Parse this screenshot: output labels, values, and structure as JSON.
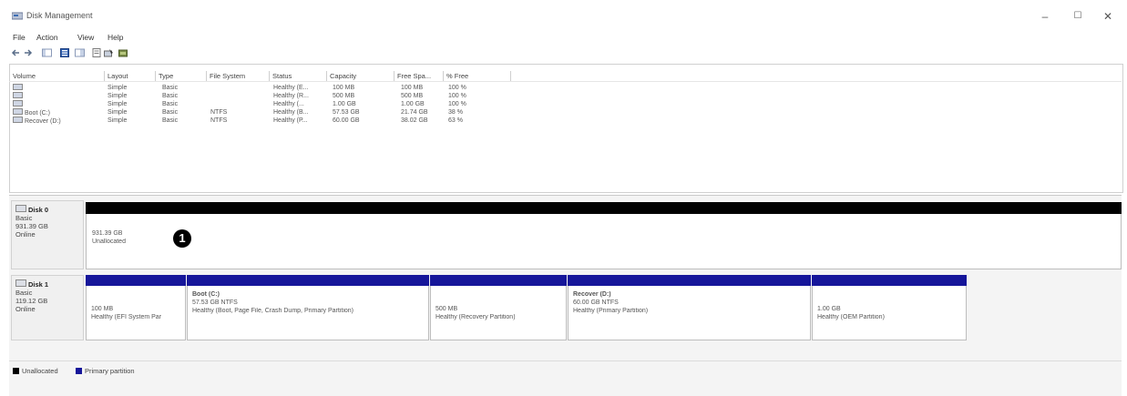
{
  "window": {
    "title": "Disk Management",
    "controls": {
      "minimize": "–",
      "maximize": "☐",
      "close": "✕"
    }
  },
  "menu": [
    "File",
    "Action",
    "View",
    "Help"
  ],
  "toolbar": {
    "icons": [
      "back-arrow-icon",
      "forward-arrow-icon",
      "console-tree-icon",
      "properties-icon",
      "help-icon",
      "refresh-icon",
      "disk-settings-icon",
      "folder-icon"
    ]
  },
  "volume_table": {
    "columns": [
      "Volume",
      "Layout",
      "Type",
      "File System",
      "Status",
      "Capacity",
      "Free Spa...",
      "% Free"
    ],
    "rows": [
      {
        "volume": "",
        "layout": "Simple",
        "type": "Basic",
        "fs": "",
        "status": "Healthy (E...",
        "capacity": "100 MB",
        "free": "100 MB",
        "pct": "100 %"
      },
      {
        "volume": "",
        "layout": "Simple",
        "type": "Basic",
        "fs": "",
        "status": "Healthy (R...",
        "capacity": "500 MB",
        "free": "500 MB",
        "pct": "100 %"
      },
      {
        "volume": "",
        "layout": "Simple",
        "type": "Basic",
        "fs": "",
        "status": "Healthy (...",
        "capacity": "1.00 GB",
        "free": "1.00 GB",
        "pct": "100 %"
      },
      {
        "volume": "Boot (C:)",
        "layout": "Simple",
        "type": "Basic",
        "fs": "NTFS",
        "status": "Healthy (B...",
        "capacity": "57.53 GB",
        "free": "21.74 GB",
        "pct": "38 %"
      },
      {
        "volume": "Recover (D:)",
        "layout": "Simple",
        "type": "Basic",
        "fs": "NTFS",
        "status": "Healthy (P...",
        "capacity": "60.00 GB",
        "free": "38.02 GB",
        "pct": "63 %"
      }
    ]
  },
  "disks": [
    {
      "name": "Disk 0",
      "kind": "Basic",
      "size": "931.39 GB",
      "state": "Online",
      "partitions": [
        {
          "title": "",
          "line1": "931.39 GB",
          "line2": "Unallocated"
        }
      ]
    },
    {
      "name": "Disk 1",
      "kind": "Basic",
      "size": "119.12 GB",
      "state": "Online",
      "partitions": [
        {
          "title": "",
          "line1": "100 MB",
          "line2": "Healthy (EFI System Par"
        },
        {
          "title": "Boot (C:)",
          "line1": "57.53 GB NTFS",
          "line2": "Healthy (Boot, Page File, Crash Dump, Primary Partition)"
        },
        {
          "title": "",
          "line1": "500 MB",
          "line2": "Healthy (Recovery Partition)"
        },
        {
          "title": "Recover (D:)",
          "line1": "60.00 GB NTFS",
          "line2": "Healthy (Primary Partition)"
        },
        {
          "title": "",
          "line1": "1.00 GB",
          "line2": "Healthy (OEM Partition)"
        }
      ]
    }
  ],
  "callout_number": "1",
  "legend": [
    {
      "label": "Unallocated",
      "color": "#000000"
    },
    {
      "label": "Primary partition",
      "color": "#16169a"
    }
  ]
}
